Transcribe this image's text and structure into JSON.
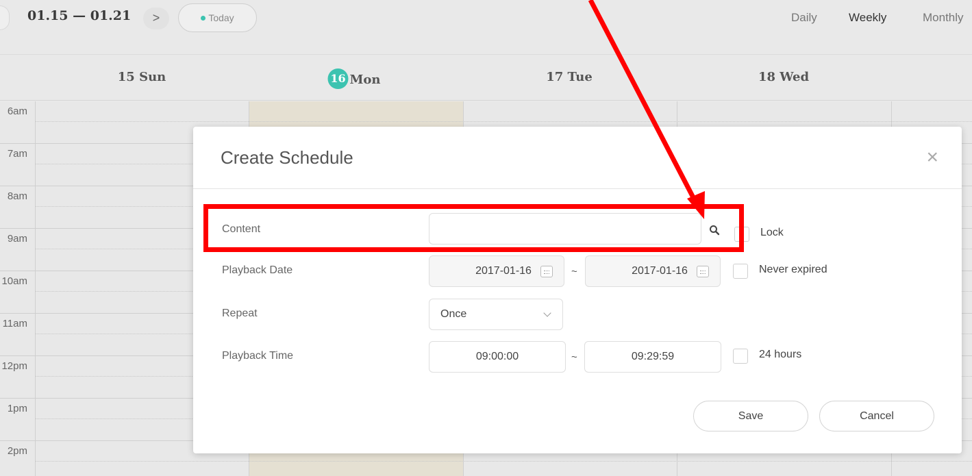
{
  "toolbar": {
    "date_range": "01.15 — 01.21",
    "next_glyph": ">",
    "today_label": "Today",
    "views": [
      "Daily",
      "Weekly",
      "Monthly"
    ],
    "active_view": "Weekly"
  },
  "days": [
    {
      "label": "15 Sun",
      "today": false
    },
    {
      "day": "16",
      "label": "Mon",
      "today": true
    },
    {
      "label": "17 Tue",
      "today": false
    },
    {
      "label": "18 Wed",
      "today": false
    }
  ],
  "hours": [
    "6am",
    "7am",
    "8am",
    "9am",
    "10am",
    "11am",
    "12pm",
    "1pm",
    "2pm"
  ],
  "modal": {
    "title": "Create Schedule",
    "close_glyph": "×",
    "content": {
      "label": "Content",
      "value": "",
      "lock_label": "Lock",
      "lock_checked": false
    },
    "playback_date": {
      "label": "Playback Date",
      "start": "2017-01-16",
      "separator": "~",
      "end": "2017-01-16",
      "never_expired_label": "Never expired",
      "never_expired_checked": false
    },
    "repeat": {
      "label": "Repeat",
      "value": "Once"
    },
    "playback_time": {
      "label": "Playback Time",
      "start": "09:00:00",
      "separator": "~",
      "end": "09:29:59",
      "all_day_label": "24 hours",
      "all_day_checked": false
    },
    "save_label": "Save",
    "cancel_label": "Cancel"
  },
  "colors": {
    "accent": "#3cc3b0",
    "annotation": "#ff0000",
    "today_column": "#e5e0d2"
  },
  "icons": [
    "chevron-right-icon",
    "search-icon",
    "calendar-icon",
    "chevron-down-icon",
    "close-icon"
  ]
}
